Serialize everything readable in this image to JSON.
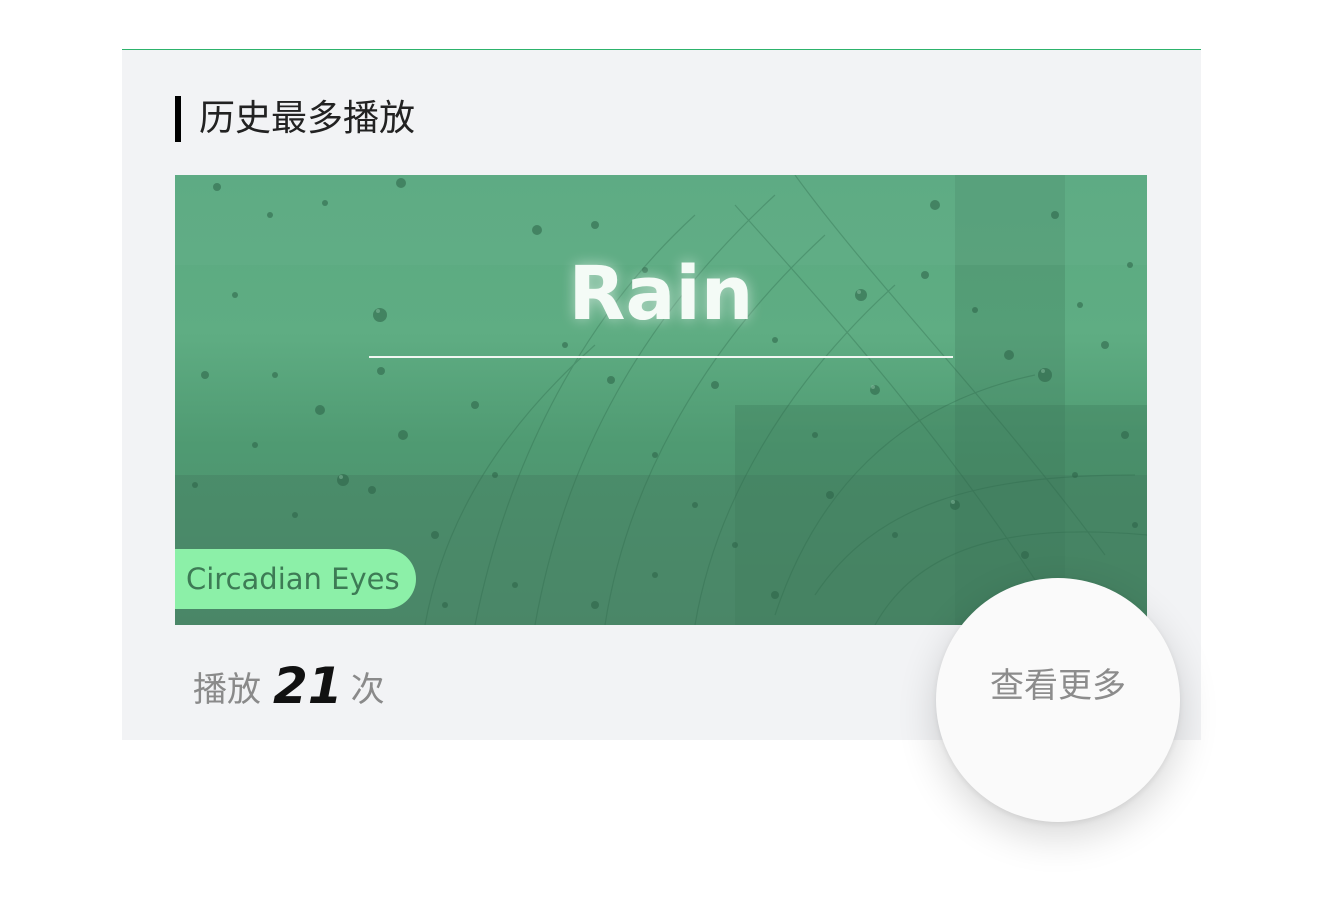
{
  "section": {
    "title": "历史最多播放"
  },
  "cover": {
    "title": "Rain",
    "artist": "Circadian Eyes"
  },
  "stats": {
    "prefix": "播放",
    "count": "21",
    "suffix": "次"
  },
  "actions": {
    "more_label": "查看更多"
  },
  "colors": {
    "accent_line": "#2db36c",
    "card_bg": "#f2f3f5",
    "cover_green": "#5aa981",
    "artist_tag": "#8cf0a8"
  }
}
